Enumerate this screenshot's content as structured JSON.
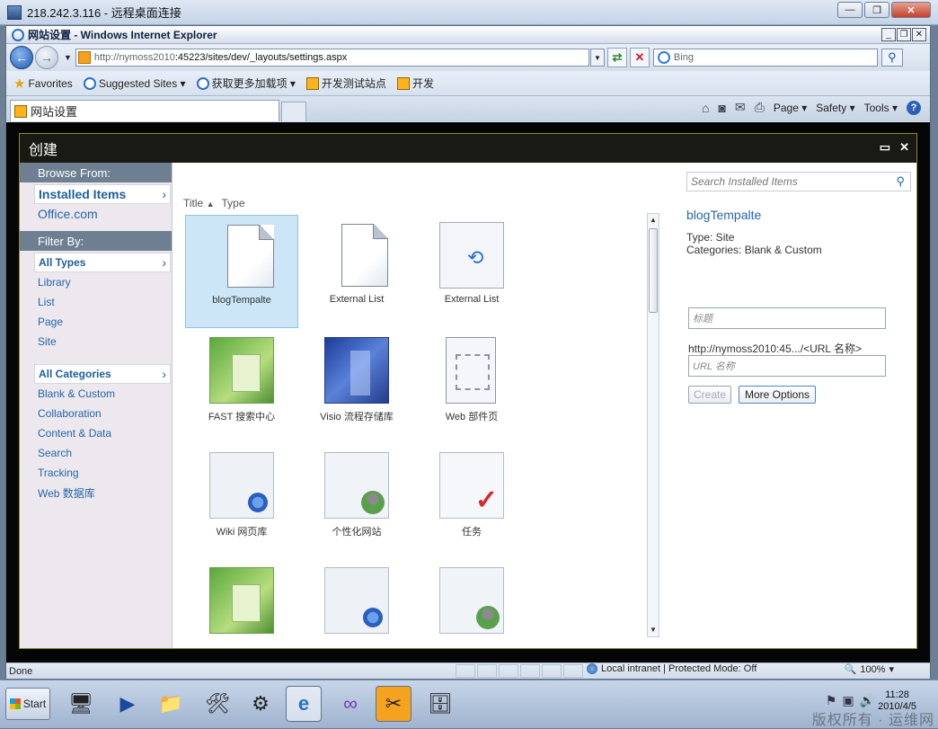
{
  "rdp": {
    "title": "218.242.3.116 - 远程桌面连接"
  },
  "ie": {
    "title": "网站设置 - Windows Internet Explorer",
    "address": {
      "url_prefix": "http://nymoss2010",
      "url_rest": ":45223/sites/dev/_layouts/settings.aspx"
    },
    "search": {
      "placeholder": "Bing"
    },
    "favorites": [
      {
        "label": "Favorites",
        "icon": "star-icon"
      },
      {
        "label": "Suggested Sites ▾",
        "icon": "ie-icon"
      },
      {
        "label": "获取更多加载项 ▾",
        "icon": "ie-icon"
      },
      {
        "label": "开发测试站点",
        "icon": "sharepoint-icon"
      },
      {
        "label": "开发",
        "icon": "sharepoint-icon"
      }
    ],
    "tab": {
      "label": "网站设置"
    },
    "commands": {
      "page": "Page ▾",
      "safety": "Safety ▾",
      "tools": "Tools ▾"
    },
    "status": {
      "text": "Done",
      "zone": "Local intranet | Protected Mode: Off",
      "zoom": "100%"
    }
  },
  "dialog": {
    "title": "创建",
    "browse": {
      "header": "Browse From:",
      "selected": "Installed Items",
      "other": "Office.com"
    },
    "filter": {
      "header": "Filter By:",
      "types_selected": "All Types",
      "types": [
        "Library",
        "List",
        "Page",
        "Site"
      ],
      "categories_selected": "All Categories",
      "categories": [
        "Blank & Custom",
        "Collaboration",
        "Content & Data",
        "Search",
        "Tracking",
        "Web 数据库"
      ]
    },
    "sort": {
      "title": "Title",
      "type": "Type"
    },
    "items": [
      {
        "label": "blogTempalte",
        "thumb": "doc",
        "selected": true
      },
      {
        "label": "External List",
        "thumb": "doc"
      },
      {
        "label": "External List",
        "thumb": "sync"
      },
      {
        "label": "FAST 搜索中心",
        "thumb": "green"
      },
      {
        "label": "Visio 流程存储库",
        "thumb": "blue"
      },
      {
        "label": "Web 部件页",
        "thumb": "page"
      },
      {
        "label": "Wiki 网页库",
        "thumb": "wiki"
      },
      {
        "label": "个性化网站",
        "thumb": "people"
      },
      {
        "label": "任务",
        "thumb": "check"
      },
      {
        "label": "",
        "thumb": "green"
      },
      {
        "label": "",
        "thumb": "wiki"
      },
      {
        "label": "",
        "thumb": "people"
      }
    ],
    "details": {
      "search_placeholder": "Search Installed Items",
      "name": "blogTempalte",
      "type_line": "Type: Site",
      "categories_line": "Categories: Blank & Custom",
      "title_placeholder": "标题",
      "url_prefix": "http://nymoss2010:45.../<URL 名称>",
      "url_placeholder": "URL 名称",
      "create_label": "Create",
      "more_label": "More Options"
    }
  },
  "taskbar": {
    "start": "Start",
    "clock_time": "11:28",
    "clock_date": "2010/4/5",
    "watermark": "版权所有 · 运维网"
  }
}
